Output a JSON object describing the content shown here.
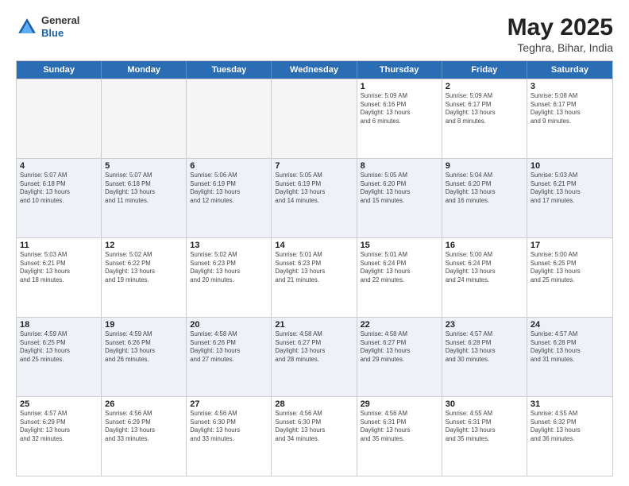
{
  "header": {
    "logo": {
      "general": "General",
      "blue": "Blue"
    },
    "title": "May 2025",
    "subtitle": "Teghra, Bihar, India"
  },
  "weekdays": [
    "Sunday",
    "Monday",
    "Tuesday",
    "Wednesday",
    "Thursday",
    "Friday",
    "Saturday"
  ],
  "rows": [
    {
      "alt": false,
      "cells": [
        {
          "empty": true,
          "day": "",
          "info": ""
        },
        {
          "empty": true,
          "day": "",
          "info": ""
        },
        {
          "empty": true,
          "day": "",
          "info": ""
        },
        {
          "empty": true,
          "day": "",
          "info": ""
        },
        {
          "empty": false,
          "day": "1",
          "info": "Sunrise: 5:09 AM\nSunset: 6:16 PM\nDaylight: 13 hours\nand 6 minutes."
        },
        {
          "empty": false,
          "day": "2",
          "info": "Sunrise: 5:09 AM\nSunset: 6:17 PM\nDaylight: 13 hours\nand 8 minutes."
        },
        {
          "empty": false,
          "day": "3",
          "info": "Sunrise: 5:08 AM\nSunset: 6:17 PM\nDaylight: 13 hours\nand 9 minutes."
        }
      ]
    },
    {
      "alt": true,
      "cells": [
        {
          "empty": false,
          "day": "4",
          "info": "Sunrise: 5:07 AM\nSunset: 6:18 PM\nDaylight: 13 hours\nand 10 minutes."
        },
        {
          "empty": false,
          "day": "5",
          "info": "Sunrise: 5:07 AM\nSunset: 6:18 PM\nDaylight: 13 hours\nand 11 minutes."
        },
        {
          "empty": false,
          "day": "6",
          "info": "Sunrise: 5:06 AM\nSunset: 6:19 PM\nDaylight: 13 hours\nand 12 minutes."
        },
        {
          "empty": false,
          "day": "7",
          "info": "Sunrise: 5:05 AM\nSunset: 6:19 PM\nDaylight: 13 hours\nand 14 minutes."
        },
        {
          "empty": false,
          "day": "8",
          "info": "Sunrise: 5:05 AM\nSunset: 6:20 PM\nDaylight: 13 hours\nand 15 minutes."
        },
        {
          "empty": false,
          "day": "9",
          "info": "Sunrise: 5:04 AM\nSunset: 6:20 PM\nDaylight: 13 hours\nand 16 minutes."
        },
        {
          "empty": false,
          "day": "10",
          "info": "Sunrise: 5:03 AM\nSunset: 6:21 PM\nDaylight: 13 hours\nand 17 minutes."
        }
      ]
    },
    {
      "alt": false,
      "cells": [
        {
          "empty": false,
          "day": "11",
          "info": "Sunrise: 5:03 AM\nSunset: 6:21 PM\nDaylight: 13 hours\nand 18 minutes."
        },
        {
          "empty": false,
          "day": "12",
          "info": "Sunrise: 5:02 AM\nSunset: 6:22 PM\nDaylight: 13 hours\nand 19 minutes."
        },
        {
          "empty": false,
          "day": "13",
          "info": "Sunrise: 5:02 AM\nSunset: 6:23 PM\nDaylight: 13 hours\nand 20 minutes."
        },
        {
          "empty": false,
          "day": "14",
          "info": "Sunrise: 5:01 AM\nSunset: 6:23 PM\nDaylight: 13 hours\nand 21 minutes."
        },
        {
          "empty": false,
          "day": "15",
          "info": "Sunrise: 5:01 AM\nSunset: 6:24 PM\nDaylight: 13 hours\nand 22 minutes."
        },
        {
          "empty": false,
          "day": "16",
          "info": "Sunrise: 5:00 AM\nSunset: 6:24 PM\nDaylight: 13 hours\nand 24 minutes."
        },
        {
          "empty": false,
          "day": "17",
          "info": "Sunrise: 5:00 AM\nSunset: 6:25 PM\nDaylight: 13 hours\nand 25 minutes."
        }
      ]
    },
    {
      "alt": true,
      "cells": [
        {
          "empty": false,
          "day": "18",
          "info": "Sunrise: 4:59 AM\nSunset: 6:25 PM\nDaylight: 13 hours\nand 25 minutes."
        },
        {
          "empty": false,
          "day": "19",
          "info": "Sunrise: 4:59 AM\nSunset: 6:26 PM\nDaylight: 13 hours\nand 26 minutes."
        },
        {
          "empty": false,
          "day": "20",
          "info": "Sunrise: 4:58 AM\nSunset: 6:26 PM\nDaylight: 13 hours\nand 27 minutes."
        },
        {
          "empty": false,
          "day": "21",
          "info": "Sunrise: 4:58 AM\nSunset: 6:27 PM\nDaylight: 13 hours\nand 28 minutes."
        },
        {
          "empty": false,
          "day": "22",
          "info": "Sunrise: 4:58 AM\nSunset: 6:27 PM\nDaylight: 13 hours\nand 29 minutes."
        },
        {
          "empty": false,
          "day": "23",
          "info": "Sunrise: 4:57 AM\nSunset: 6:28 PM\nDaylight: 13 hours\nand 30 minutes."
        },
        {
          "empty": false,
          "day": "24",
          "info": "Sunrise: 4:57 AM\nSunset: 6:28 PM\nDaylight: 13 hours\nand 31 minutes."
        }
      ]
    },
    {
      "alt": false,
      "cells": [
        {
          "empty": false,
          "day": "25",
          "info": "Sunrise: 4:57 AM\nSunset: 6:29 PM\nDaylight: 13 hours\nand 32 minutes."
        },
        {
          "empty": false,
          "day": "26",
          "info": "Sunrise: 4:56 AM\nSunset: 6:29 PM\nDaylight: 13 hours\nand 33 minutes."
        },
        {
          "empty": false,
          "day": "27",
          "info": "Sunrise: 4:56 AM\nSunset: 6:30 PM\nDaylight: 13 hours\nand 33 minutes."
        },
        {
          "empty": false,
          "day": "28",
          "info": "Sunrise: 4:56 AM\nSunset: 6:30 PM\nDaylight: 13 hours\nand 34 minutes."
        },
        {
          "empty": false,
          "day": "29",
          "info": "Sunrise: 4:56 AM\nSunset: 6:31 PM\nDaylight: 13 hours\nand 35 minutes."
        },
        {
          "empty": false,
          "day": "30",
          "info": "Sunrise: 4:55 AM\nSunset: 6:31 PM\nDaylight: 13 hours\nand 35 minutes."
        },
        {
          "empty": false,
          "day": "31",
          "info": "Sunrise: 4:55 AM\nSunset: 6:32 PM\nDaylight: 13 hours\nand 36 minutes."
        }
      ]
    }
  ]
}
